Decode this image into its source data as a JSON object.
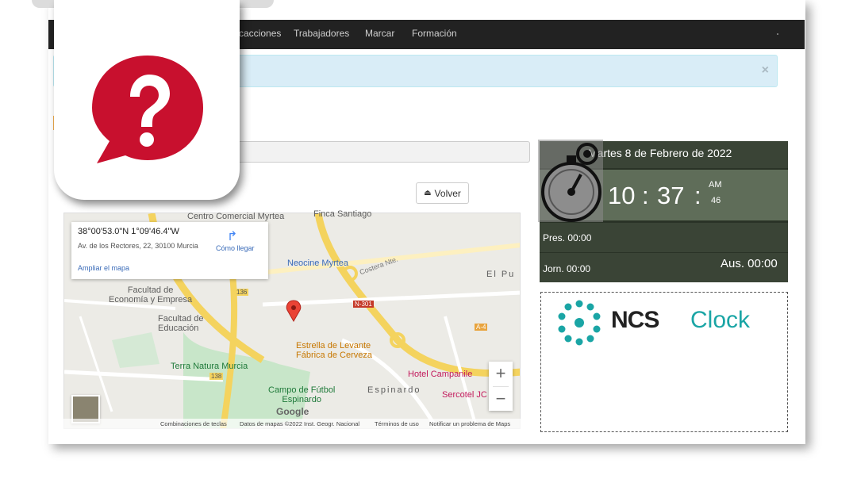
{
  "nav": {
    "items": [
      "cacciones",
      "Trabajadores",
      "Marcar",
      "Formación"
    ]
  },
  "alert": {
    "close": "×"
  },
  "actions": {
    "volver_label": "Volver"
  },
  "map": {
    "info": {
      "coords": "38°00'53.0\"N 1°09'46.4\"W",
      "address": "Av. de los Rectores, 22, 30100 Murcia",
      "directions": "Cómo llegar",
      "enlarge": "Ampliar el mapa"
    },
    "places": {
      "centro_comercial": "Centro Comercial Myrtea",
      "finca": "Finca Santiago",
      "neocine": "Neocine Myrtea",
      "facultad_economia": "Facultad de\nEconomía y Empresa",
      "facultad_educacion": "Facultad de\nEducación",
      "estrella": "Estrella de Levante\nFábrica de Cerveza",
      "terra_natura": "Terra Natura Murcia",
      "campo_futbol": "Campo de Fútbol\nEspinardo",
      "hotel": "Hotel Campanile",
      "sercotel": "Sercotel JC",
      "espinardo": "Espinardo",
      "el_pu": "El Pu",
      "costera": "Costera Nte.",
      "n301": "N-301",
      "a4": "A-4",
      "r138": "138",
      "r136": "136"
    },
    "attribution": {
      "shortcuts": "Combinaciones de teclas",
      "data": "Datos de mapas ©2022 Inst. Geogr. Nacional",
      "terms": "Términos de uso",
      "report": "Notificar un problema de Maps"
    },
    "zoom_in": "+",
    "zoom_out": "−",
    "google": "Google"
  },
  "clock": {
    "date": "Martes 8 de Febrero de 2022",
    "hours": "10",
    "minutes": "37",
    "sep": ":",
    "ampm": "AM",
    "seconds": "46",
    "pres": "Pres. 00:00",
    "jorn": "Jorn. 00:00",
    "aus": "Aus. 00:00"
  },
  "logo": {
    "ncs": "NCS",
    "clock": "Clock"
  },
  "colors": {
    "help_red": "#c8102e",
    "ncs_teal": "#1aa5a5",
    "navbar": "#222222"
  }
}
